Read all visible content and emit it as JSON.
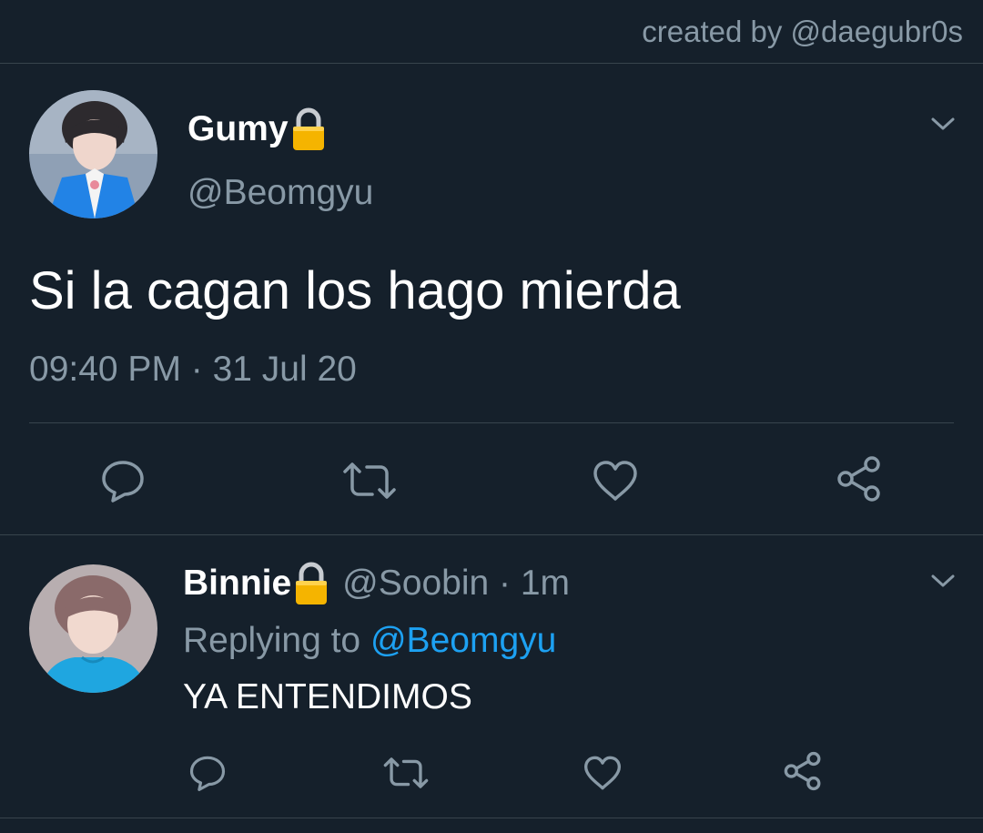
{
  "credit": "created by @daegubr0s",
  "tweet": {
    "display_name": "Gumy",
    "handle": "@Beomgyu",
    "text": "Si la cagan los hago mierda",
    "timestamp": "09:40 PM · 31 Jul 20",
    "locked_icon": "lock-icon",
    "actions": [
      "reply-icon",
      "retweet-icon",
      "like-icon",
      "share-icon"
    ]
  },
  "reply": {
    "display_name": "Binnie",
    "handle_meta": "@Soobin · 1m",
    "replying_prefix": "Replying to",
    "replying_mention": "@Beomgyu",
    "text": "YA ENTENDIMOS",
    "locked_icon": "lock-icon",
    "actions": [
      "reply-icon",
      "retweet-icon",
      "like-icon",
      "share-icon"
    ]
  },
  "colors": {
    "background": "#15202b",
    "text_primary": "#ffffff",
    "text_secondary": "#8899a6",
    "accent": "#1da1f2",
    "divider": "#38444d",
    "lock": "#f5b400"
  }
}
